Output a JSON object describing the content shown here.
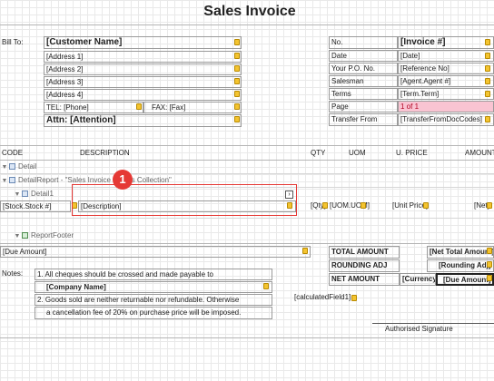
{
  "title": "Sales Invoice",
  "bill_to": {
    "label": "Bill To:",
    "customer_name": "[Customer Name]",
    "address1": "[Address 1]",
    "address2": "[Address 2]",
    "address3": "[Address 3]",
    "address4": "[Address 4]",
    "tel": "TEL: [Phone]",
    "fax": "FAX: [Fax]",
    "attn": "Attn: [Attention]"
  },
  "info": {
    "no_label": "No.",
    "no_value": "[Invoice #]",
    "date_label": "Date",
    "date_value": "[Date]",
    "po_label": "Your P.O. No.",
    "po_value": "[Reference No]",
    "salesman_label": "Salesman",
    "salesman_value": "[Agent.Agent #]",
    "terms_label": "Terms",
    "terms_value": "[Term.Term]",
    "page_label": "Page",
    "page_value": "1 of 1",
    "transfer_label": "Transfer From",
    "transfer_value": "[TransferFromDocCodes]"
  },
  "columns": {
    "code": "CODE",
    "description": "DESCRIPTION",
    "qty": "QTY",
    "uom": "UOM",
    "uprice": "U. PRICE",
    "amount": "AMOUNT"
  },
  "bands": {
    "detail": "Detail",
    "detail_report": "DetailReport - \"Sales Invoice Details Collection\"",
    "detail1": "Detail1",
    "report_footer": "ReportFooter"
  },
  "detail_row": {
    "code": "[Stock.Stock #]",
    "description": "[Description]",
    "qty": "[Qty]",
    "uom": "[UOM.UOM]",
    "uprice": "[Unit Price]",
    "net": "[Net]"
  },
  "footer": {
    "due_amount": "[Due Amount]",
    "total_amount_label": "TOTAL AMOUNT",
    "total_amount_value": "[Net Total Amount]",
    "rounding_label": "ROUNDING ADJ",
    "rounding_value": "[Rounding Adj]",
    "net_amount_label": "NET AMOUNT",
    "currency_value": "[Currency]",
    "due_value": "[Due Amount]",
    "notes_label": "Notes:",
    "note1": "1. All cheques should be crossed and made payable to",
    "company_name": "[Company Name]",
    "note2": "2. Goods sold are neither returnable nor refundable. Otherwise",
    "note3": "a cancellation fee of 20% on purchase price will be imposed.",
    "calculated_field": "[calculatedField1]",
    "signature": "Authorised Signature"
  },
  "callout": {
    "number": "1"
  },
  "colors": {
    "highlight_red": "#e53935",
    "marker_yellow": "#f4c430",
    "page_cell_pink": "#f9c4d2"
  }
}
